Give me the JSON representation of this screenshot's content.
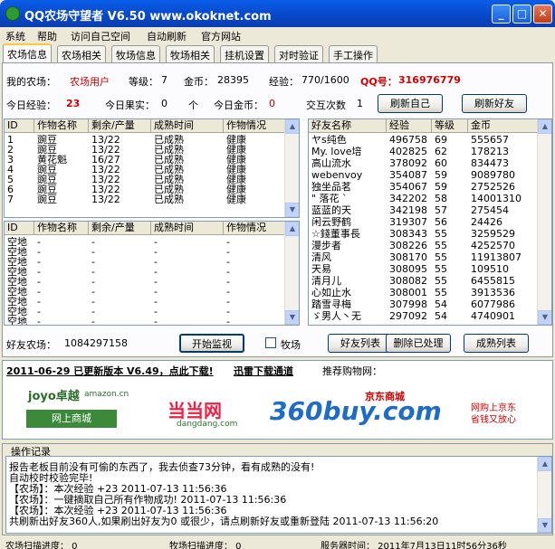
{
  "window": {
    "title": "QQ农场守望者 V6.50   www.okoknet.com",
    "minimize": "_",
    "maximize": "□",
    "close": "✕"
  },
  "menu": [
    "系统",
    "帮助",
    "访问自己空间",
    "自动刷新",
    "官方网站"
  ],
  "tabs": [
    "农场信息",
    "农场相关",
    "牧场信息",
    "牧场相关",
    "挂机设置",
    "对时验证",
    "手工操作"
  ],
  "info": {
    "my_farm_label": "我的农场：",
    "my_farm_value": "农场用户",
    "level_label": "等级：",
    "level_value": "7",
    "gold_label": "金币：",
    "gold_value": "28395",
    "exp_label": "经验：",
    "exp_value": "770/1600",
    "qq_label": "QQ号：",
    "qq_value": "316976779",
    "today_exp_label": "今日经验：",
    "today_exp_value": "23",
    "today_fruit_label": "今日果实：",
    "today_fruit_value": "0",
    "unit_ge": "个",
    "today_gold_label": "今日金币：",
    "today_gold_value": "0",
    "interact_label": "交互次数",
    "interact_value": "1",
    "refresh_self": "刷新自己",
    "refresh_friends": "刷新好友"
  },
  "crops": {
    "headers": [
      "ID",
      "作物名称",
      "剩余/产量",
      "成熟时间",
      "作物情况"
    ],
    "rows": [
      [
        "1",
        "豌豆",
        "13/22",
        "已成熟",
        "健康"
      ],
      [
        "2",
        "豌豆",
        "13/22",
        "已成熟",
        "健康"
      ],
      [
        "3",
        "黄花魁",
        "16/27",
        "已成熟",
        "健康"
      ],
      [
        "4",
        "豌豆",
        "13/22",
        "已成熟",
        "健康"
      ],
      [
        "5",
        "豌豆",
        "13/22",
        "已成熟",
        "健康"
      ],
      [
        "6",
        "豌豆",
        "13/22",
        "已成熟",
        "健康"
      ],
      [
        "7",
        "豌豆",
        "13/22",
        "已成熟",
        "健康"
      ]
    ]
  },
  "empty_lands": {
    "headers": [
      "ID",
      "作物名称",
      "剩余/产量",
      "成熟时间",
      "作物情况"
    ],
    "rows": [
      [
        "空地",
        "-",
        "-",
        "-",
        "-"
      ],
      [
        "空地",
        "-",
        "-",
        "-",
        "-"
      ],
      [
        "空地",
        "-",
        "-",
        "-",
        "-"
      ],
      [
        "空地",
        "-",
        "-",
        "-",
        "-"
      ],
      [
        "空地",
        "-",
        "-",
        "-",
        "-"
      ],
      [
        "空地",
        "-",
        "-",
        "-",
        "-"
      ],
      [
        "空地",
        "-",
        "-",
        "-",
        "-"
      ],
      [
        "空地",
        "-",
        "-",
        "-",
        "-"
      ],
      [
        "空地",
        "-",
        "-",
        "-",
        "-"
      ],
      [
        "8",
        "牧草",
        "已收割",
        "-",
        "健康"
      ]
    ]
  },
  "friends": {
    "headers": [
      "好友名称",
      "经验",
      "等级",
      "金币"
    ],
    "rows": [
      [
        "ヤs纯色",
        "496758",
        "69",
        "555657"
      ],
      [
        "My. love培",
        "402825",
        "62",
        "178213"
      ],
      [
        "高山流水",
        "378092",
        "60",
        "834473"
      ],
      [
        "webenvoy",
        "354087",
        "59",
        "9089780"
      ],
      [
        "独坐品茗",
        "354067",
        "59",
        "2752526"
      ],
      [
        "\" 落花 `",
        "342202",
        "58",
        "14001310"
      ],
      [
        "蓝蓝的天",
        "342198",
        "57",
        "275454"
      ],
      [
        "闲云野鹤",
        "319307",
        "56",
        "24426"
      ],
      [
        "☆錢董事長",
        "308343",
        "55",
        "3259529"
      ],
      [
        "漫步者",
        "308226",
        "55",
        "4252570"
      ],
      [
        "清风",
        "308170",
        "55",
        "11913807"
      ],
      [
        "天易",
        "308095",
        "55",
        "109510"
      ],
      [
        "清月儿",
        "308082",
        "55",
        "6455815"
      ],
      [
        "心如止水",
        "308001",
        "55",
        "3913536"
      ],
      [
        "踏雪寻梅",
        "307998",
        "54",
        "6077986"
      ],
      [
        "ゞ男人丶无",
        "297092",
        "54",
        "4740901"
      ]
    ]
  },
  "actions": {
    "friend_farm_label": "好友农场：",
    "friend_farm_value": "1084297158",
    "start_monitor": "开始监视",
    "ranch_checkbox": "牧场",
    "friend_list": "好友列表",
    "delete_processed": "删除已处理",
    "mature_list": "成熟列表"
  },
  "ad": {
    "update_notice": "2011-06-29 已更新版本 V6.49，点此下载!",
    "download_channel": "迅雷下载通道",
    "shop_label": "推荐购物网：",
    "joyo_top": "joyo卓越",
    "joyo_mid": "amazon.cn",
    "joyo_bottom": "网上商城",
    "dangdang": "当当网",
    "dangdang_sub": "dangdang.com",
    "buy360": "360buy.com",
    "buy360_brand": "京东商城",
    "buy360_slogan1": "网购上京东",
    "buy360_slogan2": "省钱又放心"
  },
  "log": {
    "title": "操作记录",
    "lines": [
      "报告老板目前没有可偷的东西了，我去侦查73分钟，看有成熟的没有!",
      "自动校时校验完毕!",
      "【农场】：本次经验 +23        2011-07-13 11:56:36",
      "【农场】：一键摘取自己所有作物成功!      2011-07-13 11:56:36",
      "【农场】：本次经验 +23        2011-07-13 11:56:36",
      "共刷新出好友360人,如果刷出好友为0 或很少，请点刷新好友或重新登陆       2011-07-13 11:56:20"
    ]
  },
  "status": {
    "farm_scan": "农场扫描进度：   0",
    "ranch_scan": "牧场扫描进度：   0",
    "server_time": "服务器时间：   2011年7月13日11时56分36秒"
  },
  "colors": {
    "accent_red": "#d40000",
    "title_blue": "#0a5ee9"
  }
}
